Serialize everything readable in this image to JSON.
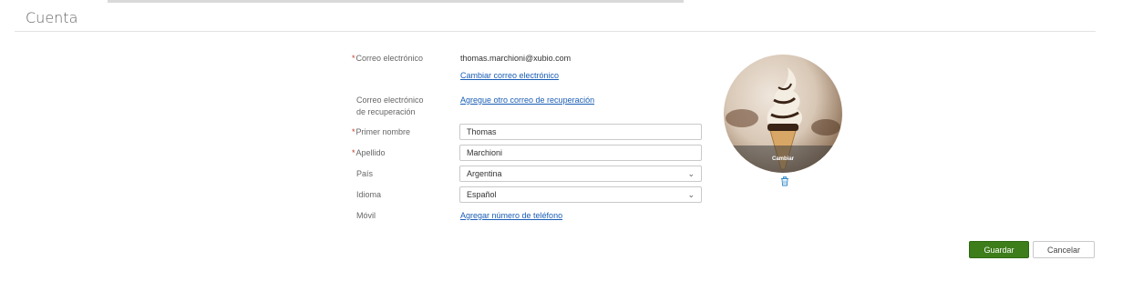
{
  "page": {
    "title": "Cuenta"
  },
  "account": {
    "email_label": "Correo electrónico",
    "email_value": "thomas.marchioni@xubio.com",
    "change_email_link": "Cambiar correo electrónico",
    "recovery_label_line1": "Correo electrónico",
    "recovery_label_line2": "de recuperación",
    "add_recovery_link": "Agregue otro correo de recuperación",
    "first_name_label": "Primer nombre",
    "first_name_value": "Thomas",
    "last_name_label": "Apellido",
    "last_name_value": "Marchioni",
    "country_label": "País",
    "country_value": "Argentina",
    "language_label": "Idioma",
    "language_value": "Español",
    "mobile_label": "Móvil",
    "add_phone_link": "Agregar número de teléfono",
    "required_mark": "*"
  },
  "avatar": {
    "change_label": "Cambiar",
    "icon": "trash-icon"
  },
  "actions": {
    "save_label": "Guardar",
    "cancel_label": "Cancelar"
  },
  "colors": {
    "primary": "#3d7d1a",
    "link": "#1a5db5",
    "required": "#c0392b"
  }
}
